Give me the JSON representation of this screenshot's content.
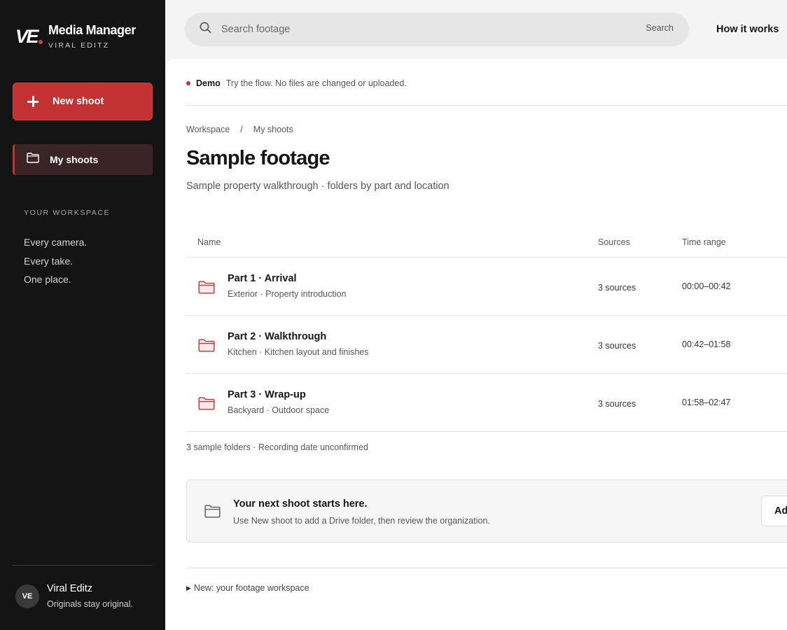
{
  "brand": {
    "logo": "VE",
    "title": "Media Manager",
    "subtitle": "VIRAL EDITZ",
    "accent": "#c23232"
  },
  "sidebar": {
    "new_shoot_label": "New shoot",
    "nav": [
      {
        "label": "My shoots",
        "icon": "folder-icon",
        "active": true
      }
    ],
    "workspace_heading": "YOUR WORKSPACE",
    "workspace_lines": [
      "Every camera.",
      "Every take.",
      "One place."
    ],
    "user": {
      "initials": "VE",
      "name": "Viral Editz",
      "tagline": "Originals stay original."
    }
  },
  "topbar": {
    "search": {
      "placeholder": "Search footage",
      "button_label": "Search"
    },
    "how_it_works": "How it works"
  },
  "main": {
    "demo": {
      "badge": "Demo",
      "message": "Try the flow. No files are changed or uploaded."
    },
    "breadcrumb": [
      "Workspace",
      "My shoots"
    ],
    "breadcrumb_sep": "/",
    "title": "Sample footage",
    "subtitle": "Sample property walkthrough · folders by part and location",
    "table": {
      "headers": {
        "name": "Name",
        "sources": "Sources",
        "time": "Time range"
      },
      "rows": [
        {
          "title": "Part 1 · Arrival",
          "subtitle": "Exterior · Property introduction",
          "sources": "3 sources",
          "time": "00:00–00:42"
        },
        {
          "title": "Part 2 · Walkthrough",
          "subtitle": "Kitchen · Kitchen layout and finishes",
          "sources": "3 sources",
          "time": "00:42–01:58"
        },
        {
          "title": "Part 3 · Wrap-up",
          "subtitle": "Backyard · Outdoor space",
          "sources": "3 sources",
          "time": "01:58–02:47"
        }
      ]
    },
    "summary": "3 sample folders · Recording date unconfirmed",
    "cta": {
      "title": "Your next shoot starts here.",
      "subtitle": "Use New shoot to add a Drive folder, then review the organization.",
      "button_label": "Add"
    },
    "new_toggle": "New: your footage workspace"
  }
}
